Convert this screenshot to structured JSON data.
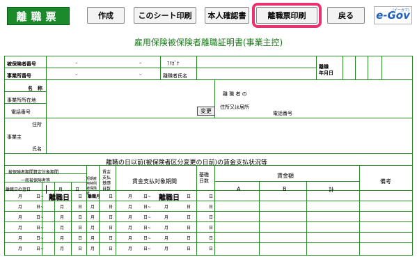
{
  "toolbar": {
    "title": "離職票",
    "create": "作成",
    "print_sheet": "このシート印刷",
    "confirm": "本人確認書",
    "print_form": "離職票印刷",
    "back": "戻る",
    "egov_logo": "e-Gov",
    "egov_small": "(イーガブ)"
  },
  "form": {
    "title": "雇用保険被保険者離職証明書(事業主控)",
    "insured_no": "被保険者番号",
    "office_no": "事業所番号",
    "dash": "–",
    "furigana": "ﾌﾘｶﾞﾅ",
    "separated_name": "離職者氏名",
    "separation_date": "離職\n年月日",
    "name": "名　称",
    "office_address": "事業所所在地",
    "phone": "電話番号",
    "separated_person": "離 職 者 の",
    "address_or_residence": "住所又は居所",
    "phone2": "電話番号",
    "change_button": "変更",
    "employer_address": "住所",
    "employer": "事業主",
    "employer_name": "氏名",
    "wage_status": "離職の日以前(被保険者区分変更の日前)の賃金支払状況等",
    "period_header": "被保険者期間算定対象期間",
    "general_insured": "一般被保険者等",
    "day_after": "離職日の翌日",
    "month": "月",
    "day": "日",
    "short_term": "短期雇用特例被保険者",
    "wage_days": "賃金支払基礎日数",
    "pay_period": "賃金支払対象期間",
    "base_days": "基礎日数",
    "wage_amount": "賃金額",
    "col_a": "A",
    "col_b": "B",
    "col_total": "計",
    "remarks": "備考",
    "separation_day": "離職日",
    "separation_month": "離職月",
    "tilde": "~"
  }
}
